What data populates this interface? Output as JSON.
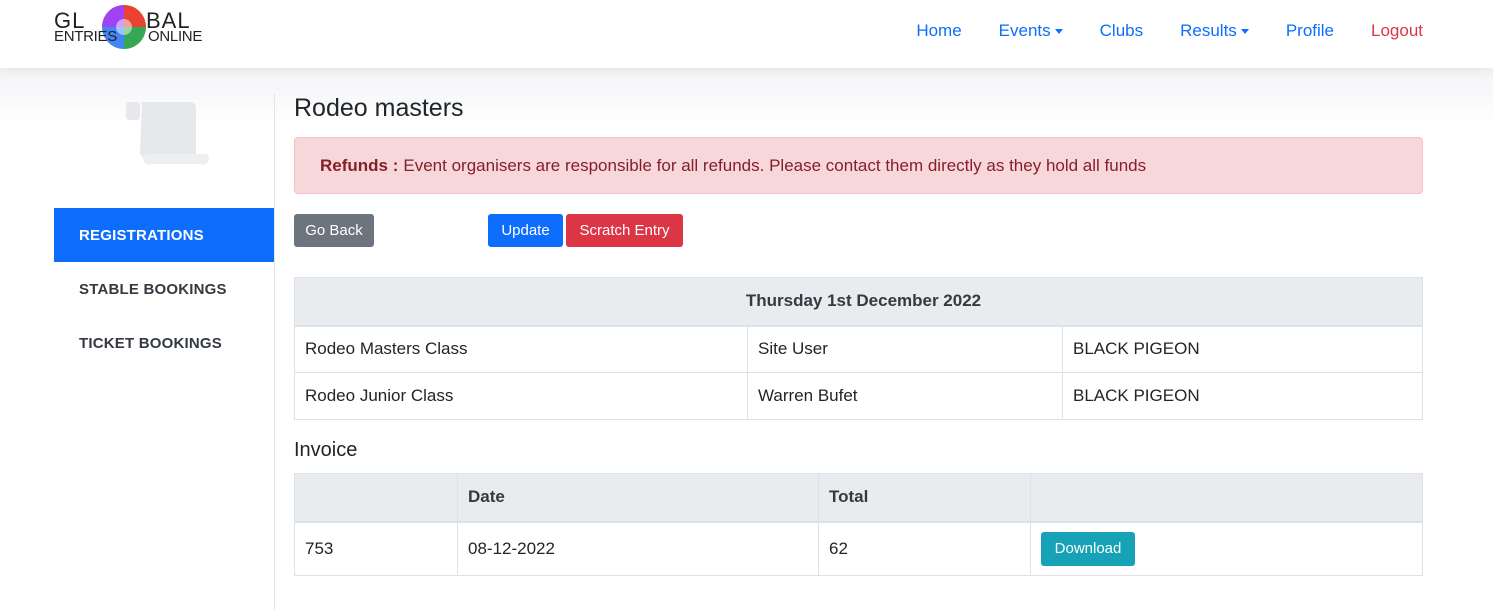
{
  "brand": {
    "top_left": "GL",
    "top_right": "BAL",
    "bottom_left": "ENTRIES",
    "bottom_right": "ONLINE"
  },
  "nav": {
    "home": "Home",
    "events": "Events",
    "clubs": "Clubs",
    "results": "Results",
    "profile": "Profile",
    "logout": "Logout"
  },
  "sidebar": {
    "items": [
      {
        "label": "REGISTRATIONS",
        "active": true
      },
      {
        "label": "STABLE BOOKINGS",
        "active": false
      },
      {
        "label": "TICKET BOOKINGS",
        "active": false
      }
    ]
  },
  "page": {
    "title": "Rodeo masters",
    "alert_label": "Refunds :",
    "alert_text": "Event organisers are responsible for all refunds. Please contact them directly as they hold all funds"
  },
  "actions": {
    "go_back": "Go Back",
    "update": "Update",
    "scratch": "Scratch Entry"
  },
  "entries": {
    "date_header": "Thursday 1st December 2022",
    "rows": [
      [
        "Rodeo Masters Class",
        "Site User",
        "BLACK PIGEON"
      ],
      [
        "Rodeo Junior Class",
        "Warren Bufet",
        "BLACK PIGEON"
      ]
    ]
  },
  "invoice": {
    "heading": "Invoice",
    "headers": [
      "",
      "Date",
      "Total",
      ""
    ],
    "rows": [
      {
        "number": "753",
        "date": "08-12-2022",
        "total": "62",
        "action": "Download"
      }
    ]
  },
  "colors": {
    "primary": "#0d6efd",
    "danger": "#dc3545",
    "secondary": "#6c757d",
    "info": "#17a2b8",
    "alert_bg": "#f8d7da"
  }
}
